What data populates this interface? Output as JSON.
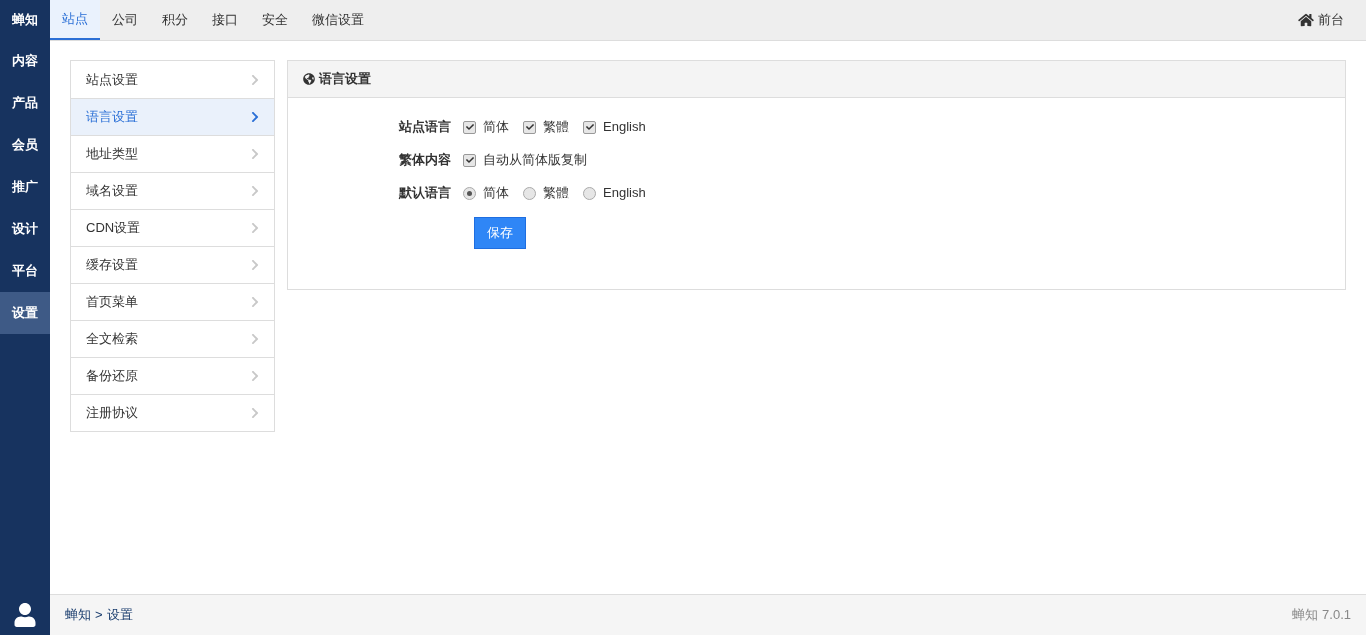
{
  "sidebar": {
    "brand": "蝉知",
    "items": [
      {
        "label": "内容",
        "selected": false
      },
      {
        "label": "产品",
        "selected": false
      },
      {
        "label": "会员",
        "selected": false
      },
      {
        "label": "推广",
        "selected": false
      },
      {
        "label": "设计",
        "selected": false
      },
      {
        "label": "平台",
        "selected": false
      },
      {
        "label": "设置",
        "selected": true
      }
    ]
  },
  "tabs": [
    {
      "label": "站点",
      "selected": true
    },
    {
      "label": "公司",
      "selected": false
    },
    {
      "label": "积分",
      "selected": false
    },
    {
      "label": "接口",
      "selected": false
    },
    {
      "label": "安全",
      "selected": false
    },
    {
      "label": "微信设置",
      "selected": false
    }
  ],
  "frontend_link": "前台",
  "menu": [
    {
      "label": "站点设置",
      "selected": false
    },
    {
      "label": "语言设置",
      "selected": true
    },
    {
      "label": "地址类型",
      "selected": false
    },
    {
      "label": "域名设置",
      "selected": false
    },
    {
      "label": "CDN设置",
      "selected": false
    },
    {
      "label": "缓存设置",
      "selected": false
    },
    {
      "label": "首页菜单",
      "selected": false
    },
    {
      "label": "全文检索",
      "selected": false
    },
    {
      "label": "备份还原",
      "selected": false
    },
    {
      "label": "注册协议",
      "selected": false
    }
  ],
  "panel": {
    "title": "语言设置",
    "rows": [
      {
        "label": "站点语言",
        "kind": "checkbox",
        "options": [
          {
            "label": "简体",
            "checked": true
          },
          {
            "label": "繁體",
            "checked": true
          },
          {
            "label": "English",
            "checked": true
          }
        ]
      },
      {
        "label": "繁体内容",
        "kind": "checkbox",
        "options": [
          {
            "label": "自动从简体版复制",
            "checked": true
          }
        ]
      },
      {
        "label": "默认语言",
        "kind": "radio",
        "options": [
          {
            "label": "简体",
            "selected": true
          },
          {
            "label": "繁體",
            "selected": false
          },
          {
            "label": "English",
            "selected": false
          }
        ]
      }
    ],
    "save_button": "保存"
  },
  "footer": {
    "breadcrumb": [
      "蝉知",
      "设置"
    ],
    "separator": ">",
    "version": "蝉知 7.0.1"
  }
}
